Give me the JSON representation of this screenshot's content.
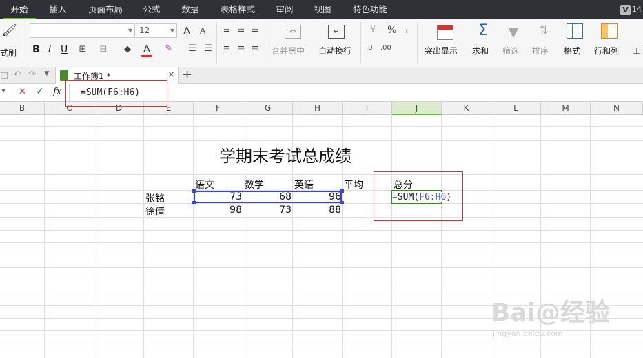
{
  "menu": {
    "tabs": [
      "开始",
      "插入",
      "页面布局",
      "公式",
      "数据",
      "表格样式",
      "审阅",
      "视图",
      "特色功能"
    ],
    "badge": "V",
    "badge_text": "14"
  },
  "ribbon": {
    "format_painter": "式刷",
    "font_name": "",
    "font_size": "12",
    "grow_font": "A",
    "shrink_font": "A",
    "bold": "B",
    "italic": "I",
    "underline": "U",
    "merge_center": "合并居中",
    "wrap_text": "自动换行",
    "percent": "%",
    "comma": ",",
    "dec_inc": ".0",
    "dec_dec": ".00",
    "highlight": "突出显示",
    "sum": "求和",
    "filter": "筛选",
    "sort": "排序",
    "format": "格式",
    "rowcol": "行和列",
    "worksheet": "工"
  },
  "tabs": {
    "doc_name": "工作簿1 *",
    "add": "+",
    "close": "×"
  },
  "formula_bar": {
    "cancel": "✕",
    "confirm": "✓",
    "fx": "fx",
    "formula": "=SUM(F6:H6)"
  },
  "columns": [
    "B",
    "C",
    "D",
    "E",
    "F",
    "G",
    "H",
    "I",
    "J",
    "K",
    "L",
    "M",
    "N"
  ],
  "sheet": {
    "title": "学期末考试总成绩",
    "headers": {
      "chinese": "语文",
      "math": "数学",
      "english": "英语",
      "avg": "平均",
      "total": "总分"
    },
    "rows": [
      {
        "name": "张铭",
        "chinese": "73",
        "math": "68",
        "english": "96"
      },
      {
        "name": "徐倩",
        "chinese": "98",
        "math": "73",
        "english": "88"
      }
    ],
    "editing_prefix": "=SUM(",
    "editing_ref": "F6:H6",
    "editing_suffix": ")"
  },
  "colors": {
    "accent": "#6fb33f",
    "range": "#3a46d6",
    "annotation": "#e0302d"
  },
  "watermark": {
    "main": "Bai@经验",
    "sub": "jingyan.baidu.com"
  }
}
